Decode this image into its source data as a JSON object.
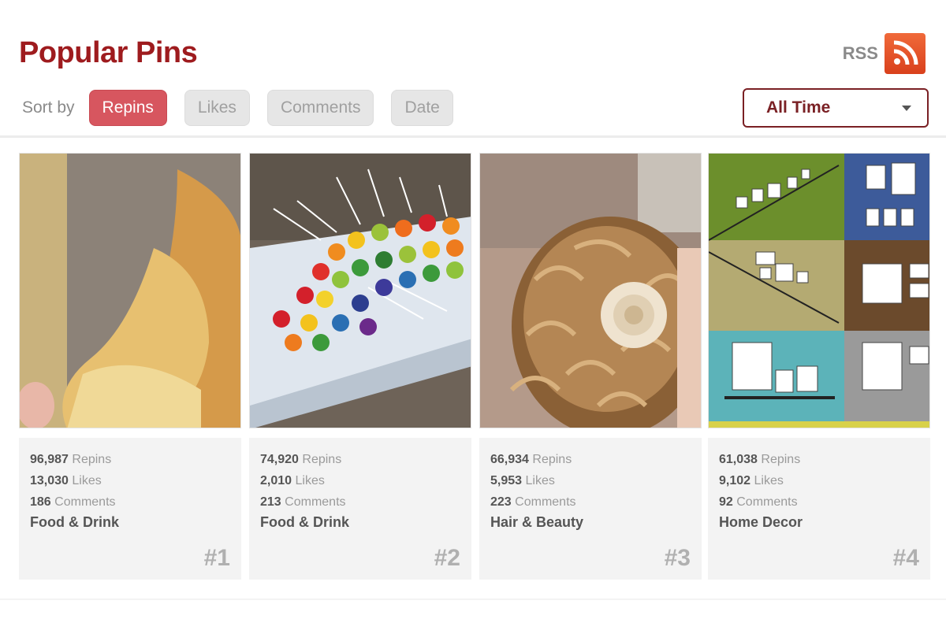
{
  "header": {
    "title": "Popular Pins",
    "rss_label": "RSS"
  },
  "sort": {
    "label": "Sort by",
    "options": [
      {
        "label": "Repins",
        "active": true
      },
      {
        "label": "Likes",
        "active": false
      },
      {
        "label": "Comments",
        "active": false
      },
      {
        "label": "Date",
        "active": false
      }
    ]
  },
  "time_filter": {
    "selected": "All Time"
  },
  "pins": [
    {
      "repins": "96,987",
      "repins_label": "Repins",
      "likes": "13,030",
      "likes_label": "Likes",
      "comments": "186",
      "comments_label": "Comments",
      "category": "Food & Drink",
      "rank": "#1"
    },
    {
      "repins": "74,920",
      "repins_label": "Repins",
      "likes": "2,010",
      "likes_label": "Likes",
      "comments": "213",
      "comments_label": "Comments",
      "category": "Food & Drink",
      "rank": "#2"
    },
    {
      "repins": "66,934",
      "repins_label": "Repins",
      "likes": "5,953",
      "likes_label": "Likes",
      "comments": "223",
      "comments_label": "Comments",
      "category": "Hair & Beauty",
      "rank": "#3"
    },
    {
      "repins": "61,038",
      "repins_label": "Repins",
      "likes": "9,102",
      "likes_label": "Likes",
      "comments": "92",
      "comments_label": "Comments",
      "category": "Home Decor",
      "rank": "#4"
    }
  ],
  "colors": {
    "brand": "#9e1b1e",
    "active_sort": "#d7565f",
    "rss": "#e85a2c"
  },
  "icons": {
    "rss": "rss-icon",
    "dropdown": "chevron-down-icon"
  }
}
